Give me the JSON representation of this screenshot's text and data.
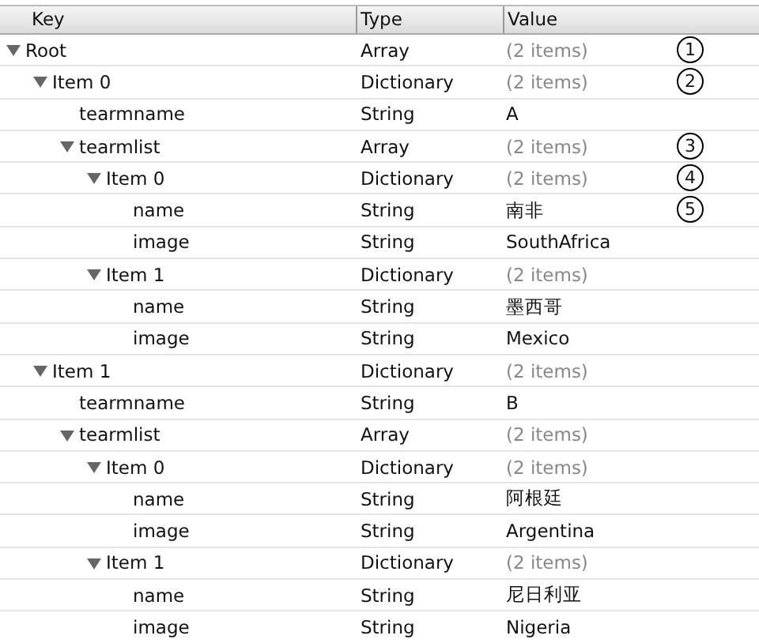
{
  "columns": [
    "Key",
    "Type",
    "Value"
  ],
  "tree": [
    {
      "key": "Root",
      "type": "Array",
      "value": "(2 items)",
      "expanded": true,
      "callout": "1",
      "children": [
        {
          "key": "Item 0",
          "type": "Dictionary",
          "value": "(2 items)",
          "expanded": true,
          "callout": "2",
          "children": [
            {
              "key": "tearmname",
              "type": "String",
              "value": "A"
            },
            {
              "key": "tearmlist",
              "type": "Array",
              "value": "(2 items)",
              "expanded": true,
              "callout": "3",
              "children": [
                {
                  "key": "Item 0",
                  "type": "Dictionary",
                  "value": "(2 items)",
                  "expanded": true,
                  "callout": "4",
                  "children": [
                    {
                      "key": "name",
                      "type": "String",
                      "value": "南非",
                      "callout": "5"
                    },
                    {
                      "key": "image",
                      "type": "String",
                      "value": "SouthAfrica"
                    }
                  ]
                },
                {
                  "key": "Item 1",
                  "type": "Dictionary",
                  "value": "(2 items)",
                  "expanded": true,
                  "children": [
                    {
                      "key": "name",
                      "type": "String",
                      "value": "墨西哥"
                    },
                    {
                      "key": "image",
                      "type": "String",
                      "value": "Mexico"
                    }
                  ]
                }
              ]
            }
          ]
        },
        {
          "key": "Item 1",
          "type": "Dictionary",
          "value": "(2 items)",
          "expanded": true,
          "children": [
            {
              "key": "tearmname",
              "type": "String",
              "value": "B"
            },
            {
              "key": "tearmlist",
              "type": "Array",
              "value": "(2 items)",
              "expanded": true,
              "children": [
                {
                  "key": "Item 0",
                  "type": "Dictionary",
                  "value": "(2 items)",
                  "expanded": true,
                  "children": [
                    {
                      "key": "name",
                      "type": "String",
                      "value": "阿根廷"
                    },
                    {
                      "key": "image",
                      "type": "String",
                      "value": "Argentina"
                    }
                  ]
                },
                {
                  "key": "Item 1",
                  "type": "Dictionary",
                  "value": "(2 items)",
                  "expanded": true,
                  "children": [
                    {
                      "key": "name",
                      "type": "String",
                      "value": "尼日利亚"
                    },
                    {
                      "key": "image",
                      "type": "String",
                      "value": "Nigeria"
                    }
                  ]
                }
              ]
            }
          ]
        }
      ]
    }
  ]
}
